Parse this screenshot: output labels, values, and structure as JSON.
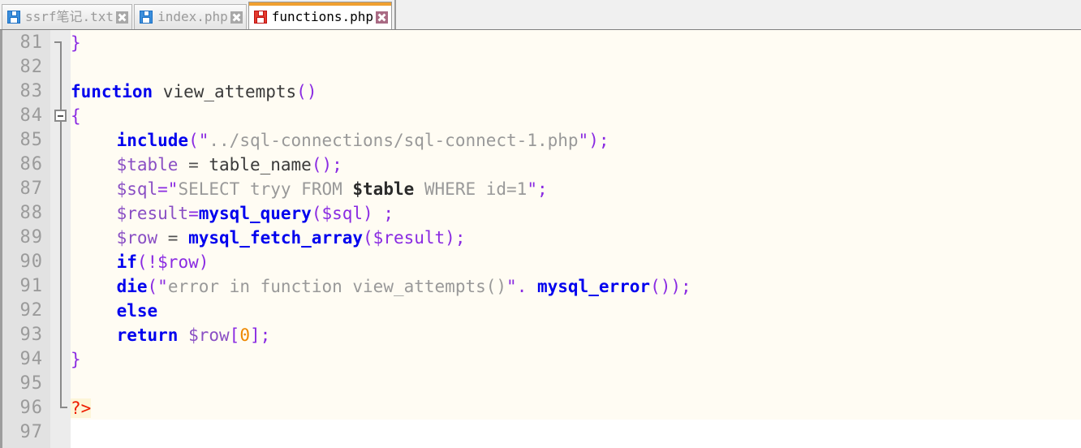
{
  "window": {
    "app": "Notepad++ style code editor",
    "active_file": "functions.php"
  },
  "tabs": [
    {
      "label": "ssrf笔记.txt",
      "icon": "floppy-disk-icon",
      "active": false,
      "close_label": "×"
    },
    {
      "label": "index.php",
      "icon": "floppy-disk-icon",
      "active": false,
      "close_label": "×"
    },
    {
      "label": "functions.php",
      "icon": "floppy-disk-icon",
      "active": true,
      "close_label": "×"
    }
  ],
  "colors": {
    "tabbar_bg": "#f0f0f0",
    "active_tab_accent": "#f0a030",
    "active_tab_close": "#a96a84",
    "inactive_tab_close": "#a8a8a8",
    "floppy_inactive": "#3c8fdc",
    "floppy_active": "#e23b2e",
    "gutter_bg": "#e2e2e2",
    "gutter_text": "#9b9b9b",
    "code_bg": "#fffcf3",
    "keyword": "#0000ee",
    "variable": "#8a4fc4",
    "punctuation": "#8a2be2",
    "string": "#999999",
    "number": "#ee8800",
    "php_tag": "#ee1c00",
    "php_tag_bg": "#fdf5d8"
  },
  "editor": {
    "first_line": 81,
    "last_line": 97,
    "line_numbers": [
      81,
      82,
      83,
      84,
      85,
      86,
      87,
      88,
      89,
      90,
      91,
      92,
      93,
      94,
      95,
      96,
      97
    ],
    "fold_markers": [
      {
        "line": 81,
        "type": "end-tick"
      },
      {
        "line": 84,
        "type": "collapse-box"
      },
      {
        "line": 94,
        "type": "mid-tick"
      },
      {
        "line": 96,
        "type": "end-tick"
      }
    ],
    "lines": {
      "l81": "}",
      "l82": "",
      "l83_kw": "function",
      "l83_name": " view_attempts",
      "l83_paren": "()",
      "l84": "{",
      "l85_kw": "include",
      "l85_open": "(\"",
      "l85_str": "../sql-connections/sql-connect-1.php",
      "l85_close": "\");",
      "l86_var": "$table",
      "l86_eq": " = ",
      "l86_fn": "table_name",
      "l86_end": "();",
      "l87_var": "$sql",
      "l87_eq": "=\"",
      "l87_s1": "SELECT tryy FROM ",
      "l87_interp": "$table",
      "l87_s2": " WHERE id=1",
      "l87_end": "\";",
      "l88_var": "$result",
      "l88_eq": "=",
      "l88_fn": "mysql_query",
      "l88_args": "($sql) ;",
      "l89_var": "$row",
      "l89_eq": " = ",
      "l89_fn": "mysql_fetch_array",
      "l89_args": "($result);",
      "l90_kw": "if",
      "l90_cond": "(!$row)",
      "l91_kw": "die",
      "l91_open": "(\"",
      "l91_str": "error in function view_attempts()",
      "l91_mid": "\". ",
      "l91_fn": "mysql_error",
      "l91_end": "());",
      "l92_kw": "else",
      "l93_kw": "return",
      "l93_var": " $row",
      "l93_br1": "[",
      "l93_num": "0",
      "l93_br2": "];",
      "l94": "}",
      "l95": "",
      "l96": "?>",
      "l97": ""
    }
  }
}
